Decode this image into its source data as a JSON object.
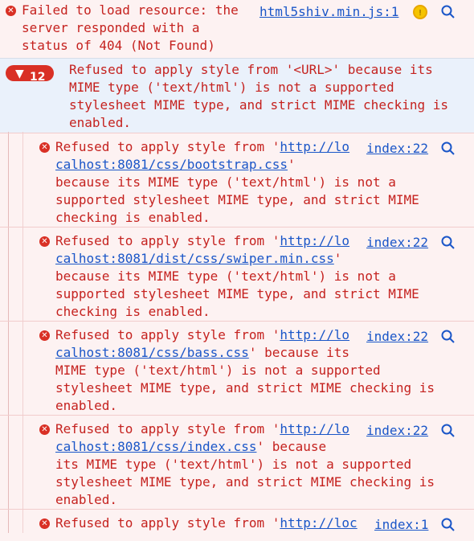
{
  "messages": [
    {
      "lines": [
        "Failed to load resource: the",
        "server responded with a",
        "status of 404 (Not Found)"
      ],
      "source": "html5shiv.min.js:1"
    }
  ],
  "group": {
    "count": "12",
    "lines": [
      "Refused to apply style from '<URL>' because its",
      "MIME type ('text/html') is not a supported",
      "stylesheet MIME type, and strict MIME checking is",
      "enabled."
    ]
  },
  "sub_messages": [
    {
      "pre": "Refused to apply style from '",
      "url1": "http://lo",
      "url2": "calhost:8081/css/bootstrap.css",
      "after_url": "'",
      "rest": [
        "because its MIME type ('text/html') is not a",
        "supported stylesheet MIME type, and strict MIME",
        "checking is enabled."
      ],
      "source": "index:22"
    },
    {
      "pre": "Refused to apply style from '",
      "url1": "http://lo",
      "url2": "calhost:8081/dist/css/swiper.min.css",
      "after_url": "'",
      "rest": [
        "because its MIME type ('text/html') is not a",
        "supported stylesheet MIME type, and strict MIME",
        "checking is enabled."
      ],
      "source": "index:22"
    },
    {
      "pre": "Refused to apply style from '",
      "url1": "http://lo",
      "url2": "calhost:8081/css/bass.css",
      "after_url": "' because its",
      "rest": [
        "MIME type ('text/html') is not a supported",
        "stylesheet MIME type, and strict MIME checking is",
        "enabled."
      ],
      "source": "index:22"
    },
    {
      "pre": "Refused to apply style from '",
      "url1": "http://lo",
      "url2": "calhost:8081/css/index.css",
      "after_url": "' because",
      "rest": [
        "its MIME type ('text/html') is not a supported",
        "stylesheet MIME type, and strict MIME checking is",
        "enabled."
      ],
      "source": "index:22"
    },
    {
      "pre": "Refused to apply style from '",
      "url1": "http://loc",
      "url2": "",
      "after_url": "",
      "rest": [],
      "source": "index:1"
    }
  ],
  "colors": {
    "error_text": "#c5221f",
    "error_bg": "#fdf2f2",
    "link": "#1a56c8",
    "group_bg": "#eaf1fb"
  }
}
